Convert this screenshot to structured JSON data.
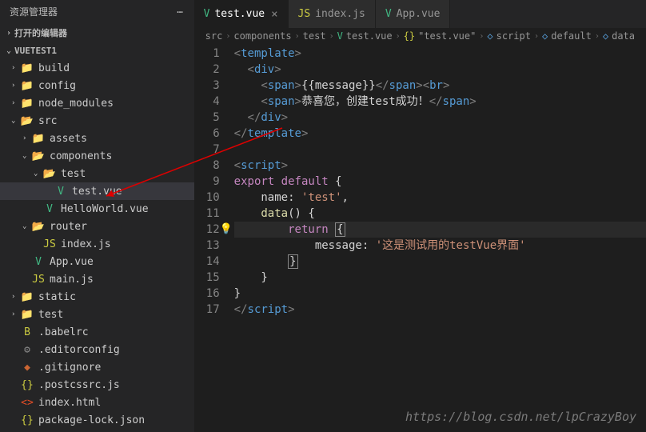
{
  "sidebar": {
    "title": "资源管理器",
    "sections": {
      "openEditors": "打开的编辑器",
      "project": "VUETEST1"
    },
    "tree": [
      {
        "d": 1,
        "chev": ">",
        "icon": "📁",
        "cls": "folder-y",
        "label": "build"
      },
      {
        "d": 1,
        "chev": ">",
        "icon": "📁",
        "cls": "folder-y",
        "label": "config"
      },
      {
        "d": 1,
        "chev": ">",
        "icon": "📁",
        "cls": "folder-g",
        "label": "node_modules"
      },
      {
        "d": 1,
        "chev": "v",
        "icon": "📂",
        "cls": "folder-y",
        "label": "src"
      },
      {
        "d": 2,
        "chev": ">",
        "icon": "📁",
        "cls": "folder-b",
        "label": "assets"
      },
      {
        "d": 2,
        "chev": "v",
        "icon": "📂",
        "cls": "folder-y",
        "label": "components"
      },
      {
        "d": 3,
        "chev": "v",
        "icon": "📂",
        "cls": "folder-y",
        "label": "test"
      },
      {
        "d": 4,
        "chev": "",
        "icon": "V",
        "cls": "vue",
        "label": "test.vue",
        "active": true
      },
      {
        "d": 3,
        "chev": "",
        "icon": "V",
        "cls": "vue",
        "label": "HelloWorld.vue"
      },
      {
        "d": 2,
        "chev": "v",
        "icon": "📂",
        "cls": "folder-g",
        "label": "router"
      },
      {
        "d": 3,
        "chev": "",
        "icon": "JS",
        "cls": "js",
        "label": "index.js"
      },
      {
        "d": 2,
        "chev": "",
        "icon": "V",
        "cls": "vue",
        "label": "App.vue"
      },
      {
        "d": 2,
        "chev": "",
        "icon": "JS",
        "cls": "js",
        "label": "main.js"
      },
      {
        "d": 1,
        "chev": ">",
        "icon": "📁",
        "cls": "folder-y",
        "label": "static"
      },
      {
        "d": 1,
        "chev": ">",
        "icon": "📁",
        "cls": "folder-g",
        "label": "test"
      },
      {
        "d": 1,
        "chev": "",
        "icon": "B",
        "cls": "babel",
        "label": ".babelrc"
      },
      {
        "d": 1,
        "chev": "",
        "icon": "⚙",
        "cls": "cfg",
        "label": ".editorconfig"
      },
      {
        "d": 1,
        "chev": "",
        "icon": "◆",
        "cls": "git",
        "label": ".gitignore"
      },
      {
        "d": 1,
        "chev": "",
        "icon": "{}",
        "cls": "json",
        "label": ".postcssrc.js"
      },
      {
        "d": 1,
        "chev": "",
        "icon": "<>",
        "cls": "html",
        "label": "index.html"
      },
      {
        "d": 1,
        "chev": "",
        "icon": "{}",
        "cls": "json",
        "label": "package-lock.json"
      }
    ]
  },
  "tabs": [
    {
      "icon": "V",
      "cls": "vue",
      "label": "test.vue",
      "active": true,
      "close": true
    },
    {
      "icon": "JS",
      "cls": "js",
      "label": "index.js",
      "active": false,
      "close": false
    },
    {
      "icon": "V",
      "cls": "vue",
      "label": "App.vue",
      "active": false,
      "close": false
    }
  ],
  "breadcrumb": [
    {
      "label": "src"
    },
    {
      "label": "components"
    },
    {
      "label": "test"
    },
    {
      "icon": "V",
      "cls": "vue",
      "label": "test.vue"
    },
    {
      "icon": "{}",
      "cls": "json",
      "label": "\"test.vue\""
    },
    {
      "icon": "◇",
      "cls": "kw",
      "label": "script"
    },
    {
      "icon": "◇",
      "cls": "kw",
      "label": "default"
    },
    {
      "icon": "◇",
      "cls": "kw",
      "label": "data"
    }
  ],
  "code": {
    "lines": [
      {
        "n": 1,
        "html": "<span class='tag'>&lt;</span><span class='tagn'>template</span><span class='tag'>&gt;</span>"
      },
      {
        "n": 2,
        "html": "  <span class='tag'>&lt;</span><span class='tagn'>div</span><span class='tag'>&gt;</span>"
      },
      {
        "n": 3,
        "html": "    <span class='tag'>&lt;</span><span class='tagn'>span</span><span class='tag'>&gt;</span><span class='tmpl'>{{message}}</span><span class='tag'>&lt;/</span><span class='tagn'>span</span><span class='tag'>&gt;&lt;</span><span class='tagn'>br</span><span class='tag'>&gt;</span>"
      },
      {
        "n": 4,
        "html": "    <span class='tag'>&lt;</span><span class='tagn'>span</span><span class='tag'>&gt;</span><span class='txt'>恭喜您，创建test成功！</span><span class='tag'>&lt;/</span><span class='tagn'>span</span><span class='tag'>&gt;</span>"
      },
      {
        "n": 5,
        "html": "  <span class='tag'>&lt;/</span><span class='tagn'>div</span><span class='tag'>&gt;</span>"
      },
      {
        "n": 6,
        "html": "<span class='tag'>&lt;/</span><span class='tagn'>template</span><span class='tag'>&gt;</span>"
      },
      {
        "n": 7,
        "html": ""
      },
      {
        "n": 8,
        "html": "<span class='tag'>&lt;</span><span class='tagn'>script</span><span class='tag'>&gt;</span>"
      },
      {
        "n": 9,
        "html": "<span class='kw2'>export</span> <span class='kw2'>default</span> {"
      },
      {
        "n": 10,
        "html": "    <span class='txt'>name:</span> <span class='str'>'test'</span>,"
      },
      {
        "n": 11,
        "html": "    <span class='fn'>data</span>() {"
      },
      {
        "n": 12,
        "html": "        <span class='kw2'>return</span> <span class='cursor-box'>{</span>",
        "bulb": true,
        "hl": true
      },
      {
        "n": 13,
        "html": "            <span class='txt'>message:</span> <span class='str'>'这是测试用的testVue界面'</span>"
      },
      {
        "n": 14,
        "html": "        <span class='cursor-box'>}</span>"
      },
      {
        "n": 15,
        "html": "    }"
      },
      {
        "n": 16,
        "html": "}"
      },
      {
        "n": 17,
        "html": "<span class='tag'>&lt;/</span><span class='tagn'>script</span><span class='tag'>&gt;</span>"
      }
    ]
  },
  "watermark": "https://blog.csdn.net/lpCrazyBoy"
}
